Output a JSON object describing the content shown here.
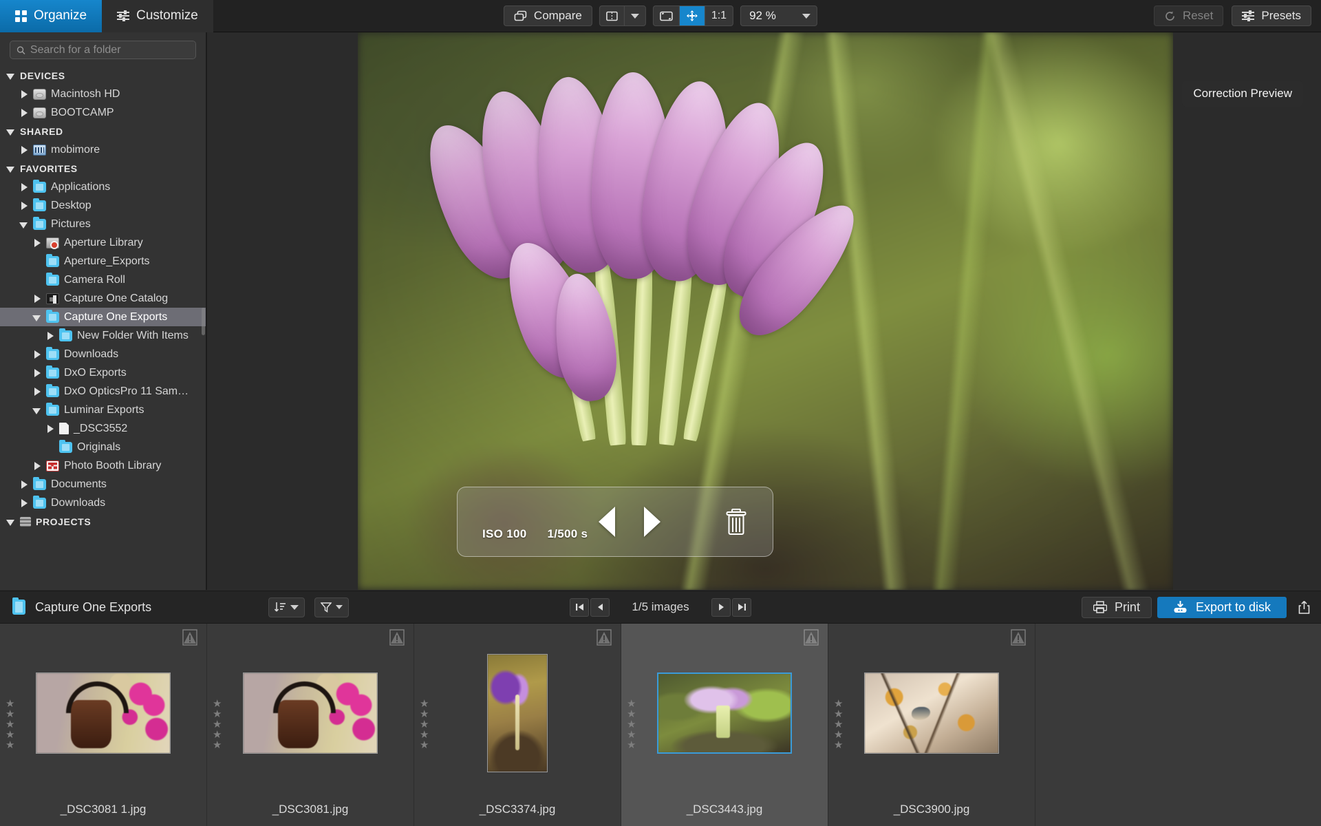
{
  "toolbar": {
    "modes": [
      {
        "label": "Organize",
        "icon": "grid-icon",
        "active": true
      },
      {
        "label": "Customize",
        "icon": "sliders-icon",
        "active": false
      }
    ],
    "compare_label": "Compare",
    "compare_icon": "compare-windows-icon",
    "view_split_icon": "split-view-icon",
    "view_split_caret": "chevron-down-icon",
    "fit_icon": "fit-to-screen-icon",
    "pan_icon": "pan-move-icon",
    "one_to_one_label": "1:1",
    "zoom_value": "92 %",
    "zoom_caret": "chevron-down-icon",
    "reset_label": "Reset",
    "reset_icon": "reset-circular-arrow-icon",
    "presets_label": "Presets",
    "presets_icon": "sliders-icon"
  },
  "sidebar": {
    "search_placeholder": "Search for a folder",
    "search_value": "",
    "search_icon": "search-icon",
    "tree": [
      {
        "label": "DEVICES",
        "type": "header",
        "indent": 0,
        "twisty": "down",
        "icon": "none"
      },
      {
        "label": "Macintosh HD",
        "type": "item",
        "indent": 1,
        "twisty": "right",
        "icon": "disk"
      },
      {
        "label": "BOOTCAMP",
        "type": "item",
        "indent": 1,
        "twisty": "right",
        "icon": "disk"
      },
      {
        "label": "SHARED",
        "type": "header",
        "indent": 0,
        "twisty": "down",
        "icon": "none"
      },
      {
        "label": "mobimore",
        "type": "item",
        "indent": 1,
        "twisty": "right",
        "icon": "network"
      },
      {
        "label": "FAVORITES",
        "type": "header",
        "indent": 0,
        "twisty": "down",
        "icon": "none"
      },
      {
        "label": "Applications",
        "type": "item",
        "indent": 1,
        "twisty": "right",
        "icon": "folder"
      },
      {
        "label": "Desktop",
        "type": "item",
        "indent": 1,
        "twisty": "right",
        "icon": "folder"
      },
      {
        "label": "Pictures",
        "type": "item",
        "indent": 1,
        "twisty": "down",
        "icon": "folder"
      },
      {
        "label": "Aperture Library",
        "type": "item",
        "indent": 2,
        "twisty": "right",
        "icon": "aperture"
      },
      {
        "label": "Aperture_Exports",
        "type": "item",
        "indent": 2,
        "twisty": "none",
        "icon": "folder"
      },
      {
        "label": "Camera Roll",
        "type": "item",
        "indent": 2,
        "twisty": "none",
        "icon": "folder"
      },
      {
        "label": "Capture One Catalog",
        "type": "item",
        "indent": 2,
        "twisty": "right",
        "icon": "c1catalog"
      },
      {
        "label": "Capture One Exports",
        "type": "item",
        "indent": 2,
        "twisty": "down",
        "icon": "folder",
        "selected": true
      },
      {
        "label": "New Folder With Items",
        "type": "item",
        "indent": 3,
        "twisty": "right",
        "icon": "folder"
      },
      {
        "label": "Downloads",
        "type": "item",
        "indent": 2,
        "twisty": "right",
        "icon": "folder"
      },
      {
        "label": "DxO Exports",
        "type": "item",
        "indent": 2,
        "twisty": "right",
        "icon": "folder"
      },
      {
        "label": "DxO OpticsPro 11 Sam…",
        "type": "item",
        "indent": 2,
        "twisty": "right",
        "icon": "folder"
      },
      {
        "label": "Luminar Exports",
        "type": "item",
        "indent": 2,
        "twisty": "down",
        "icon": "folder"
      },
      {
        "label": "_DSC3552",
        "type": "item",
        "indent": 3,
        "twisty": "right",
        "icon": "document"
      },
      {
        "label": "Originals",
        "type": "item",
        "indent": 3,
        "twisty": "none",
        "icon": "folder"
      },
      {
        "label": "Photo Booth Library",
        "type": "item",
        "indent": 2,
        "twisty": "right",
        "icon": "photobooth"
      },
      {
        "label": "Documents",
        "type": "item",
        "indent": 1,
        "twisty": "right",
        "icon": "folder"
      },
      {
        "label": "Downloads",
        "type": "item",
        "indent": 1,
        "twisty": "right",
        "icon": "folder"
      },
      {
        "label": "PROJECTS",
        "type": "header",
        "indent": 0,
        "twisty": "down",
        "icon": "projects"
      }
    ]
  },
  "viewer": {
    "correction_preview_label": "Correction Preview",
    "hud": {
      "iso": "ISO 100",
      "shutter": "1/500 s",
      "prev_icon": "previous-triangle-icon",
      "next_icon": "next-triangle-icon",
      "delete_icon": "trash-icon"
    }
  },
  "browser_bar": {
    "folder_icon": "folder-icon",
    "folder_name": "Capture One Exports",
    "sort_icon": "sort-order-icon",
    "sort_caret": "chevron-down-icon",
    "filter_icon": "funnel-filter-icon",
    "filter_caret": "chevron-down-icon",
    "first_icon": "skip-to-first-icon",
    "prev_icon": "previous-icon",
    "counter": "1/5 images",
    "next_icon": "next-icon",
    "last_icon": "skip-to-last-icon",
    "print_label": "Print",
    "print_icon": "printer-icon",
    "export_label": "Export to disk",
    "export_icon": "export-download-icon",
    "share_icon": "share-upload-icon",
    "accent_color": "#1579bd"
  },
  "filmstrip": {
    "rating_glyph": "★",
    "rating_count": 5,
    "warning_icon": "warning-triangle-icon",
    "items": [
      {
        "filename": "_DSC3081 1.jpg",
        "art": "teapot",
        "orientation": "landscape",
        "selected": false
      },
      {
        "filename": "_DSC3081.jpg",
        "art": "teapot",
        "orientation": "landscape",
        "selected": false
      },
      {
        "filename": "_DSC3374.jpg",
        "art": "crocus-v",
        "orientation": "portrait",
        "selected": false
      },
      {
        "filename": "_DSC3443.jpg",
        "art": "crocus-h",
        "orientation": "landscape",
        "selected": true
      },
      {
        "filename": "_DSC3900.jpg",
        "art": "bird",
        "orientation": "landscape",
        "selected": false
      }
    ]
  }
}
